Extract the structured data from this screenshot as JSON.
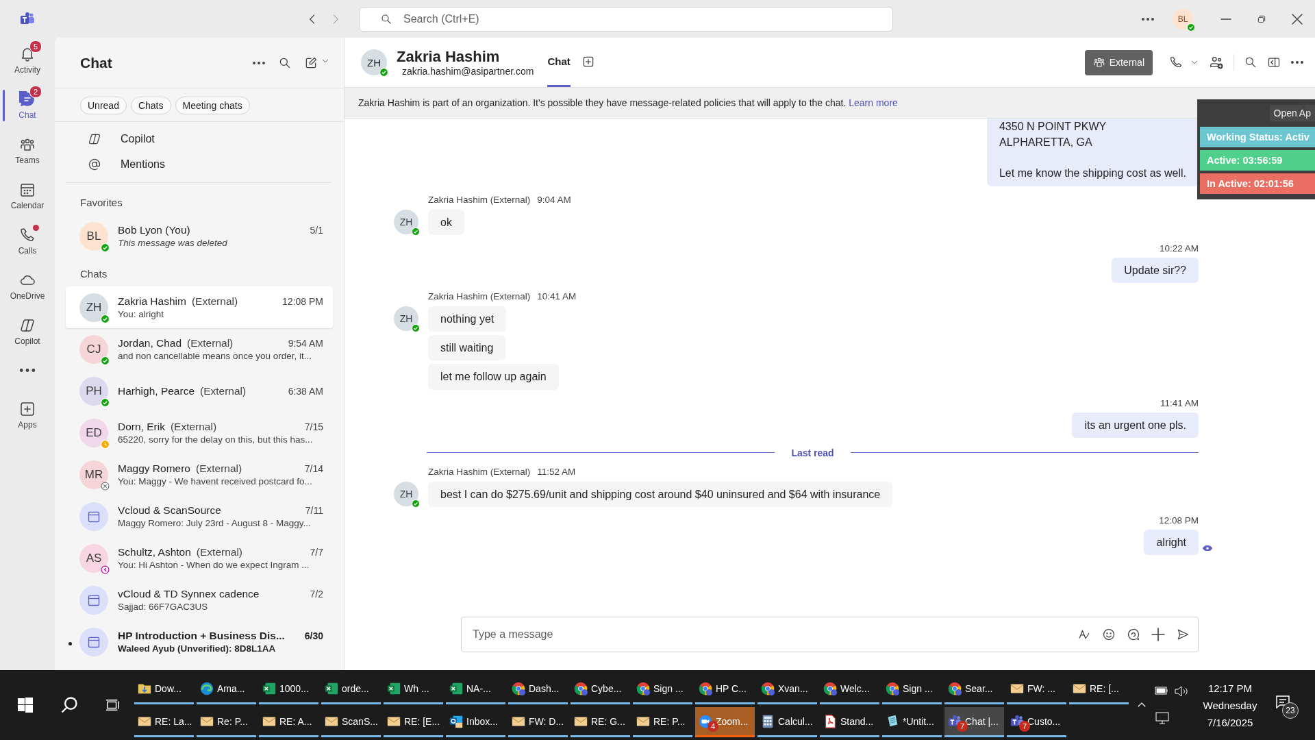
{
  "titlebar": {
    "search": {
      "placeholder": "Search (Ctrl+E)"
    },
    "user_avatar": "BL"
  },
  "rail": [
    {
      "kind": "activity",
      "label": "Activity",
      "badge": "5",
      "dot": false,
      "selected": false
    },
    {
      "kind": "chat",
      "label": "Chat",
      "badge": "2",
      "dot": false,
      "selected": true
    },
    {
      "kind": "teams",
      "label": "Teams",
      "dot": false,
      "selected": false
    },
    {
      "kind": "calendar",
      "label": "Calendar",
      "dot": false,
      "selected": false
    },
    {
      "kind": "calls",
      "label": "Calls",
      "dot": true,
      "selected": false
    },
    {
      "kind": "onedrive",
      "label": "OneDrive",
      "dot": false,
      "selected": false
    },
    {
      "kind": "copilot",
      "label": "Copilot",
      "dot": false,
      "selected": false
    },
    {
      "kind": "more",
      "dot": false,
      "selected": false
    },
    {
      "kind": "apps",
      "label": "Apps",
      "dot": false,
      "selected": false
    }
  ],
  "chat_list": {
    "title": "Chat",
    "filters": [
      "Unread",
      "Chats",
      "Meeting chats"
    ],
    "shortcuts": [
      {
        "kind": "copilot",
        "label": "Copilot"
      },
      {
        "kind": "mentions",
        "label": "Mentions"
      }
    ],
    "favorites_label": "Favorites",
    "favorites": [
      {
        "kind": "person",
        "initials": "BL",
        "color": "#fde3cf",
        "name": "Bob Lyon (You)",
        "time": "5/1",
        "preview": "This message was deleted",
        "deleted": true,
        "status": {
          "kind": "available"
        },
        "selected": false,
        "unread": false
      }
    ],
    "chats_label": "Chats",
    "chats": [
      {
        "kind": "person",
        "initials": "ZH",
        "color": "#d6dee4",
        "name": "Zakria Hashim",
        "tag": "(External)",
        "time": "12:08 PM",
        "preview": "You: alright",
        "status": {
          "kind": "available"
        },
        "selected": true,
        "unread": false
      },
      {
        "kind": "person",
        "initials": "CJ",
        "color": "#f6d5d9",
        "name": "Jordan, Chad",
        "tag": "(External)",
        "time": "9:54 AM",
        "preview": "and non cancellable means once you order, it...",
        "status": {
          "kind": "available"
        },
        "selected": false,
        "unread": false
      },
      {
        "kind": "person",
        "initials": "PH",
        "color": "#dcd9ef",
        "name": "Harhigh, Pearce",
        "tag": "(External)",
        "time": "6:38 AM",
        "status": {
          "kind": "available"
        },
        "selected": false,
        "unread": false
      },
      {
        "kind": "person",
        "initials": "ED",
        "color": "#f0d7e9",
        "name": "Dorn, Erik",
        "tag": "(External)",
        "time": "7/15",
        "preview": "65220, sorry for the delay on this, but this has...",
        "status": {
          "kind": "away"
        },
        "selected": false,
        "unread": false
      },
      {
        "kind": "person",
        "initials": "MR",
        "color": "#f6d5d9",
        "name": "Maggy Romero",
        "tag": "(External)",
        "time": "7/14",
        "preview": "You: Maggy - We havent received postcard fo...",
        "status": {
          "kind": "offline"
        },
        "selected": false,
        "unread": false
      },
      {
        "kind": "meeting",
        "color": "#dcdffa",
        "name": "Vcloud & ScanSource",
        "time": "7/11",
        "preview": "Maggy Romero: July 23rd - August 8 - Maggy...",
        "selected": false,
        "unread": false
      },
      {
        "kind": "person",
        "initials": "AS",
        "color": "#f7d5e2",
        "name": "Schultz, Ashton",
        "tag": "(External)",
        "time": "7/7",
        "preview": "You: Hi Ashton -  When do we expect Ingram ...",
        "status": {
          "kind": "out_of_office"
        },
        "selected": false,
        "unread": false
      },
      {
        "kind": "meeting",
        "color": "#dcdffa",
        "name": "vCloud & TD Synnex cadence",
        "time": "7/2",
        "preview": "Sajjad: 66F7GAC3US",
        "selected": false,
        "unread": false
      },
      {
        "kind": "meeting",
        "color": "#dcdffa",
        "name": "HP Introduction + Business Dis...",
        "time": "6/30",
        "preview": "Waleed Ayub (Unverified): 8D8L1AA",
        "selected": false,
        "unread": true
      }
    ]
  },
  "conversation": {
    "avatar": "ZH",
    "name": "Zakria Hashim",
    "email": "zakria.hashim@asipartner.com",
    "status": {
      "kind": "available"
    },
    "tabs": [
      {
        "label": "Chat",
        "selected": true
      }
    ],
    "external_button": "External",
    "banner": {
      "text": "Zakria Hashim is part of an organization. It's possible they have message-related policies that will apply to the chat.",
      "link": "Learn more"
    },
    "messages": [
      {
        "kind": "outgoing",
        "paragraphs": [
          [
            "4350 N POINT PKWY",
            "ALPHARETTA, GA"
          ],
          [
            "Let me know the shipping cost as well."
          ]
        ]
      },
      {
        "kind": "incoming",
        "avatar": "ZH",
        "sender": "Zakria Hashim (External)",
        "time": "9:04 AM",
        "bubbles": [
          "ok"
        ]
      },
      {
        "kind": "outgoing",
        "time": "10:22 AM",
        "bubbles": [
          "Update sir??"
        ]
      },
      {
        "kind": "incoming",
        "avatar": "ZH",
        "sender": "Zakria Hashim (External)",
        "time": "10:41 AM",
        "bubbles": [
          "nothing yet",
          "still waiting",
          "let me follow up again"
        ]
      },
      {
        "kind": "outgoing",
        "time": "11:41 AM",
        "bubbles": [
          "its an urgent one pls."
        ]
      },
      {
        "kind": "divider",
        "label": "Last read"
      },
      {
        "kind": "incoming",
        "avatar": "ZH",
        "sender": "Zakria Hashim (External)",
        "time": "11:52 AM",
        "bubbles": [
          "best I can do $275.69/unit and shipping cost around $40 uninsured and $64 with insurance"
        ]
      },
      {
        "kind": "outgoing",
        "time": "12:08 PM",
        "bubbles": [
          "alright"
        ],
        "read_receipt": true
      }
    ],
    "compose": {
      "placeholder": "Type a message"
    }
  },
  "status_widget": {
    "open_button": "Open Ap",
    "rows": [
      {
        "label": "Working Status: Activ",
        "color": "#6cc6cf"
      },
      {
        "label": "Active: 03:56:59",
        "color": "#4fd18b"
      },
      {
        "label": "In Active: 02:01:56",
        "color": "#ea6f62"
      }
    ]
  },
  "taskbar": {
    "rows": [
      [
        {
          "kind": "folder",
          "label": "Dow...",
          "selected": false,
          "flashing": false
        },
        {
          "kind": "edge",
          "label": "Ama...",
          "selected": false,
          "flashing": false
        },
        {
          "kind": "excel",
          "label": "1000...",
          "selected": false,
          "flashing": false
        },
        {
          "kind": "excel",
          "label": "orde...",
          "selected": false,
          "flashing": false
        },
        {
          "kind": "excel",
          "label": "Wh ...",
          "selected": false,
          "flashing": false
        },
        {
          "kind": "excel",
          "label": "NA-...",
          "selected": false,
          "flashing": false
        },
        {
          "kind": "chrome",
          "label": "Dash...",
          "selected": false,
          "flashing": false
        },
        {
          "kind": "chrome",
          "label": "Cybe...",
          "selected": false,
          "flashing": false
        },
        {
          "kind": "chrome",
          "label": "Sign ...",
          "selected": false,
          "flashing": false
        },
        {
          "kind": "chrome",
          "label": "HP C...",
          "selected": false,
          "flashing": false
        },
        {
          "kind": "chrome",
          "label": "Xvan...",
          "selected": false,
          "flashing": false
        },
        {
          "kind": "chrome",
          "label": "Welc...",
          "selected": false,
          "flashing": false
        },
        {
          "kind": "chrome",
          "label": "Sign ...",
          "selected": false,
          "flashing": false
        },
        {
          "kind": "chrome",
          "label": "Sear...",
          "selected": false,
          "flashing": false
        },
        {
          "kind": "mail",
          "label": "FW: ...",
          "selected": false,
          "flashing": false
        },
        {
          "kind": "mail",
          "label": "RE: [...",
          "selected": false,
          "flashing": false
        }
      ],
      [
        {
          "kind": "mail",
          "label": "RE: La...",
          "selected": false,
          "flashing": false
        },
        {
          "kind": "mail",
          "label": "Re: P...",
          "selected": false,
          "flashing": false
        },
        {
          "kind": "mail",
          "label": "RE: A...",
          "selected": false,
          "flashing": false
        },
        {
          "kind": "mail",
          "label": "ScanS...",
          "selected": false,
          "flashing": false
        },
        {
          "kind": "mail",
          "label": "RE: [E...",
          "selected": false,
          "flashing": false
        },
        {
          "kind": "outlook",
          "label": "Inbox...",
          "selected": false,
          "flashing": false
        },
        {
          "kind": "mail",
          "label": "FW: D...",
          "selected": false,
          "flashing": false
        },
        {
          "kind": "mail",
          "label": "RE: G...",
          "selected": false,
          "flashing": false
        },
        {
          "kind": "mail",
          "label": "RE: P...",
          "selected": false,
          "flashing": false
        },
        {
          "kind": "zoom",
          "label": "Zoom...",
          "badge": "4",
          "selected": false,
          "flashing": true
        },
        {
          "kind": "calculator",
          "label": "Calcul...",
          "selected": false,
          "flashing": false
        },
        {
          "kind": "pdf",
          "label": "Stand...",
          "selected": false,
          "flashing": false
        },
        {
          "kind": "notepad",
          "label": "*Untit...",
          "selected": false,
          "flashing": false
        },
        {
          "kind": "teams",
          "label": "Chat |...",
          "badge": "7",
          "selected": true,
          "flashing": false
        },
        {
          "kind": "teams",
          "label": "Custo...",
          "badge": "7",
          "selected": false,
          "flashing": false
        }
      ]
    ],
    "clock": {
      "time": "12:17 PM",
      "day": "Wednesday",
      "date": "7/16/2025"
    },
    "notifications": "23"
  }
}
